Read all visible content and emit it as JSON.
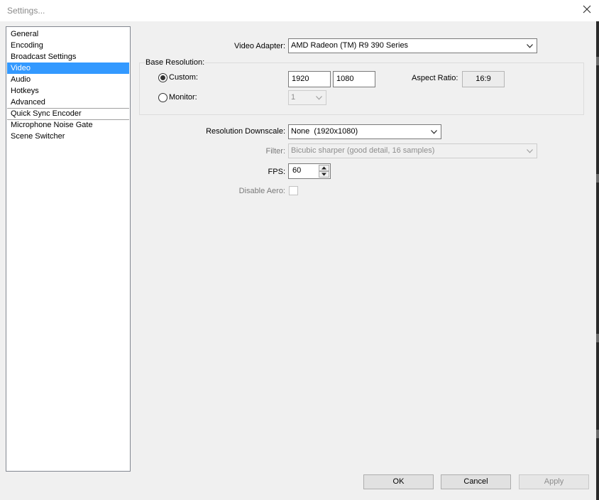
{
  "window": {
    "title": "Settings..."
  },
  "sidebar": {
    "items": [
      {
        "label": "General"
      },
      {
        "label": "Encoding"
      },
      {
        "label": "Broadcast Settings"
      },
      {
        "label": "Video",
        "selected": true
      },
      {
        "label": "Audio"
      },
      {
        "label": "Hotkeys"
      },
      {
        "label": "Advanced"
      },
      {
        "label": "Quick Sync Encoder"
      },
      {
        "label": "Microphone Noise Gate"
      },
      {
        "label": "Scene Switcher"
      }
    ]
  },
  "video": {
    "adapter_label": "Video Adapter:",
    "adapter_value": "AMD Radeon (TM) R9 390 Series",
    "base_resolution_label": "Base Resolution:",
    "custom_label": "Custom:",
    "width": "1920",
    "height": "1080",
    "aspect_label": "Aspect Ratio:",
    "aspect_value": "16:9",
    "monitor_label": "Monitor:",
    "monitor_value": "1",
    "downscale_label": "Resolution Downscale:",
    "downscale_value": "None  (1920x1080)",
    "filter_label": "Filter:",
    "filter_value": "Bicubic sharper (good detail, 16 samples)",
    "fps_label": "FPS:",
    "fps_value": "60",
    "aero_label": "Disable Aero:",
    "selected_resolution_mode": "custom",
    "disable_aero_checked": false
  },
  "buttons": {
    "ok": "OK",
    "cancel": "Cancel",
    "apply": "Apply"
  },
  "icons": {
    "close": "close-icon",
    "dropdown": "chevron-down-icon",
    "spin_up": "spin-up-icon",
    "spin_down": "spin-down-icon"
  },
  "colors": {
    "selection": "#3399ff",
    "window_bg": "#f0f0f0",
    "disabled_text": "#8d8d8d"
  }
}
